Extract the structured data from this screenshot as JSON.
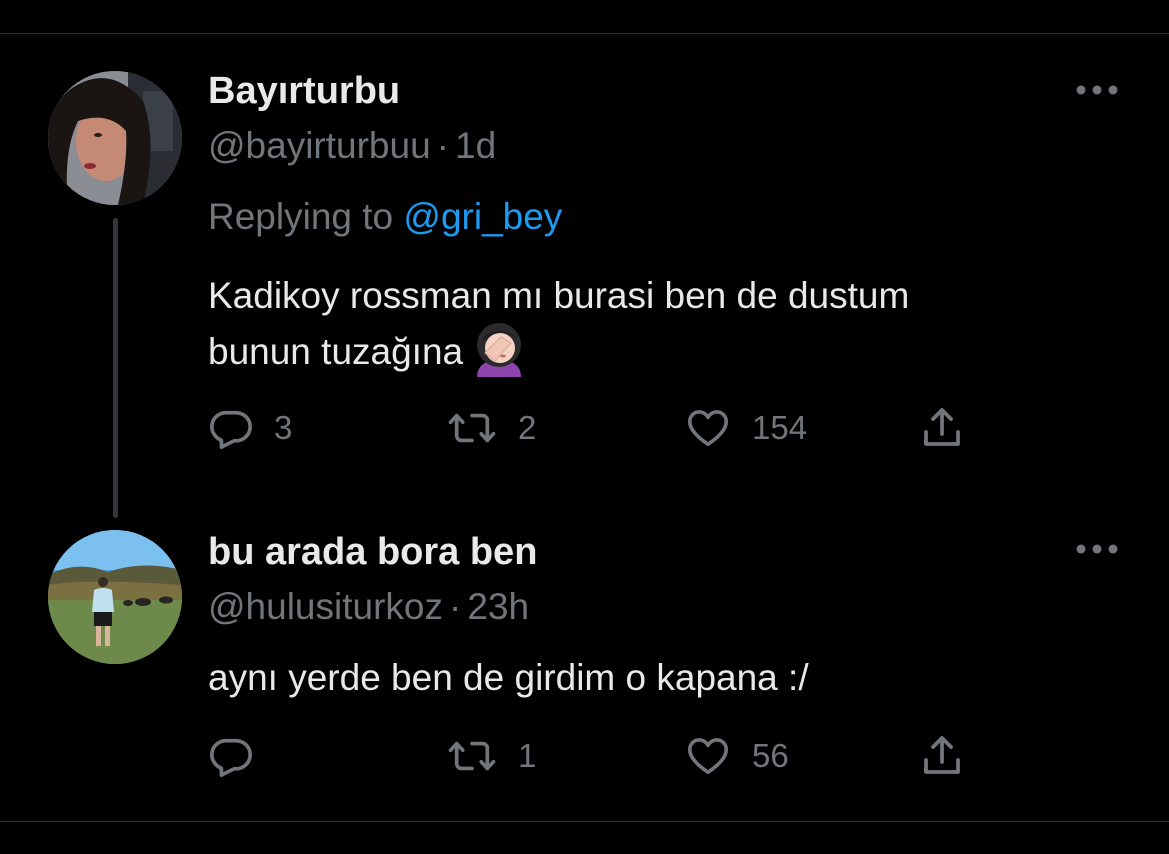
{
  "tweets": [
    {
      "display_name": "Bayırturbu",
      "handle": "@bayirturbuu",
      "separator": "·",
      "time": "1d",
      "replying_prefix": "Replying to",
      "replying_to": "@gri_bey",
      "text_line1": "Kadikoy rossman mı burasi ben de dustum",
      "text_line2": "bunun tuzağına",
      "emoji": "woman-facepalming-icon",
      "replies": "3",
      "retweets": "2",
      "likes": "154"
    },
    {
      "display_name": "bu arada bora ben",
      "handle": "@hulusiturkoz",
      "separator": "·",
      "time": "23h",
      "text": "aynı yerde ben de girdim o kapana :/",
      "replies": "",
      "retweets": "1",
      "likes": "56"
    }
  ],
  "colors": {
    "background": "#000000",
    "primary_text": "#e7e9ea",
    "secondary_text": "#71767b",
    "accent": "#1d9bf0",
    "divider": "#2f3336"
  }
}
